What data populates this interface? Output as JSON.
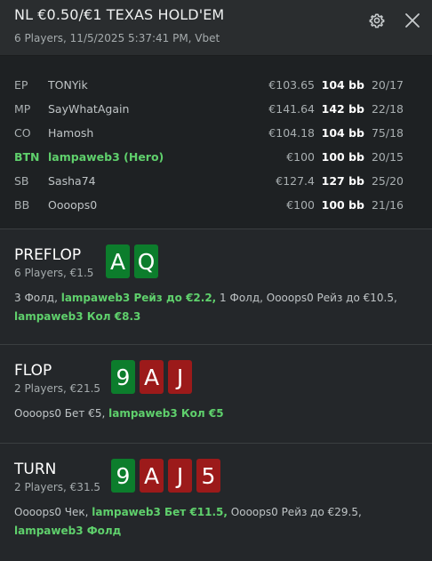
{
  "header": {
    "title": "NL €0.50/€1 TEXAS HOLD'EM",
    "subtitle": "6 Players, 11/5/2025 5:37:41 PM, Vbet"
  },
  "players": [
    {
      "pos": "EP",
      "name": "TONYik",
      "stack": "€103.65",
      "bb": "104 bb",
      "stats": "20/17",
      "hero": false
    },
    {
      "pos": "MP",
      "name": "SayWhatAgain",
      "stack": "€141.64",
      "bb": "142 bb",
      "stats": "22/18",
      "hero": false
    },
    {
      "pos": "CO",
      "name": "Hamosh",
      "stack": "€104.18",
      "bb": "104 bb",
      "stats": "75/18",
      "hero": false
    },
    {
      "pos": "BTN",
      "name": "lampaweb3 (Hero)",
      "stack": "€100",
      "bb": "100 bb",
      "stats": "20/15",
      "hero": true
    },
    {
      "pos": "SB",
      "name": "Sasha74",
      "stack": "€127.4",
      "bb": "127 bb",
      "stats": "25/20",
      "hero": false
    },
    {
      "pos": "BB",
      "name": "Oooops0",
      "stack": "€100",
      "bb": "100 bb",
      "stats": "21/16",
      "hero": false
    }
  ],
  "streets": {
    "preflop": {
      "name": "PREFLOP",
      "info": "6 Players, €1.5",
      "cards": [
        {
          "rank": "A",
          "suit": "green"
        },
        {
          "rank": "Q",
          "suit": "green"
        }
      ],
      "actions": [
        {
          "text": "3 Фолд, ",
          "hl": false
        },
        {
          "text": "lampaweb3 Рейз до €2.2,",
          "hl": true
        },
        {
          "text": " 1 Фолд, Oooops0 Рейз до €10.5,",
          "hl": false
        },
        {
          "text": "lampaweb3 Кол €8.3",
          "hl": true,
          "br": true
        }
      ]
    },
    "flop": {
      "name": "FLOP",
      "info": "2 Players, €21.5",
      "cards": [
        {
          "rank": "9",
          "suit": "green"
        },
        {
          "rank": "A",
          "suit": "red"
        },
        {
          "rank": "J",
          "suit": "red"
        }
      ],
      "actions": [
        {
          "text": "Oooops0 Бет €5, ",
          "hl": false
        },
        {
          "text": "lampaweb3 Кол €5",
          "hl": true
        }
      ]
    },
    "turn": {
      "name": "TURN",
      "info": "2 Players, €31.5",
      "cards": [
        {
          "rank": "9",
          "suit": "green"
        },
        {
          "rank": "A",
          "suit": "red"
        },
        {
          "rank": "J",
          "suit": "red"
        },
        {
          "rank": "5",
          "suit": "red"
        }
      ],
      "actions": [
        {
          "text": "Oooops0 Чек, ",
          "hl": false
        },
        {
          "text": "lampaweb3 Бет €11.5,",
          "hl": true
        },
        {
          "text": " Oooops0 Рейз до €29.5,",
          "hl": false
        },
        {
          "text": "lampaweb3 Фолд",
          "hl": true,
          "br": true
        }
      ]
    }
  },
  "colors": {
    "background": "#24272a",
    "hero_green": "#5fd06c",
    "card_green": "#0c7d2c",
    "card_red": "#9c1a1a"
  },
  "icons": {
    "settings": "gear-icon",
    "close": "close-icon"
  }
}
